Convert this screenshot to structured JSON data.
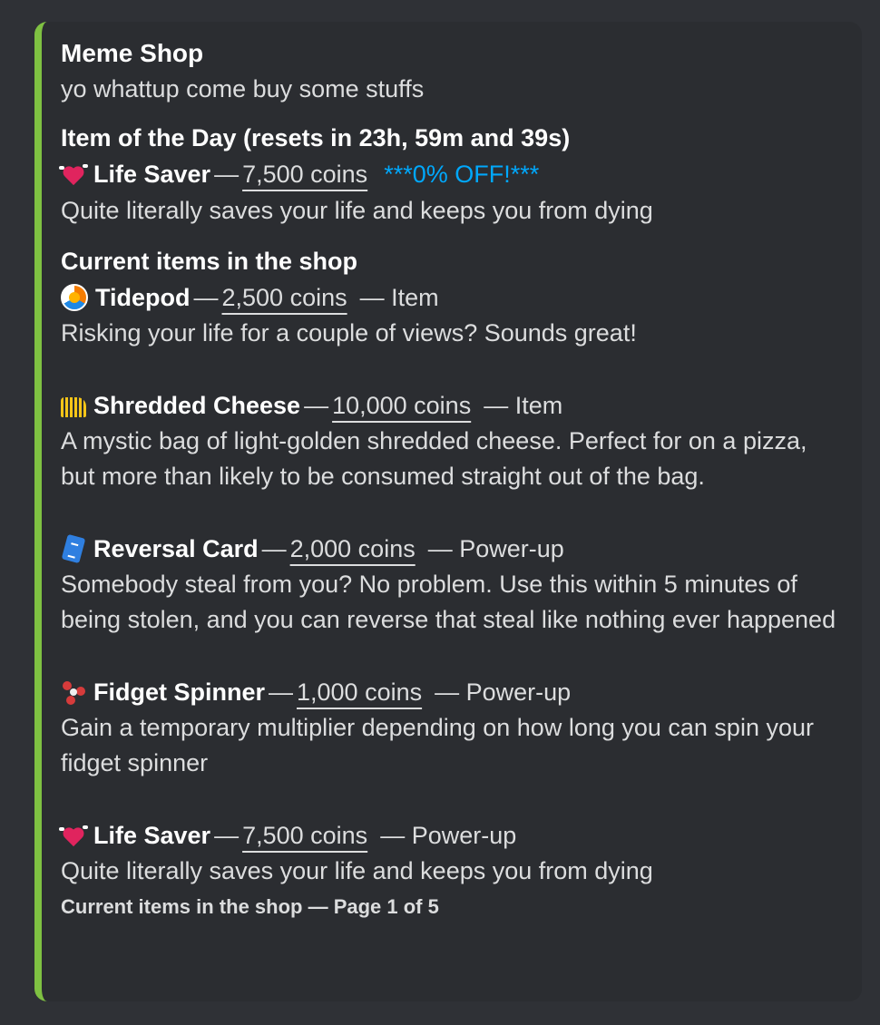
{
  "embed": {
    "accent": "#7fc142",
    "title": "Meme Shop",
    "description": "yo whattup come buy some stuffs",
    "item_of_day": {
      "heading": "Item of the Day (resets in 23h, 59m and 39s)",
      "icon": "heart-icon",
      "name": "Life Saver",
      "dash": "—",
      "price": "7,500 coins",
      "discount": "***0% OFF!***",
      "description": "Quite literally saves your life and keeps you from dying"
    },
    "current_heading": "Current items in the shop",
    "items": [
      {
        "icon": "tidepod-icon",
        "name": "Tidepod",
        "dash": "—",
        "price": "2,500 coins",
        "type": "— Item",
        "description": "Risking your life for a couple of views? Sounds great!"
      },
      {
        "icon": "cheese-icon",
        "name": "Shredded Cheese",
        "dash": "—",
        "price": "10,000 coins",
        "type": "— Item",
        "description": "A mystic bag of light-golden shredded cheese. Perfect for on a pizza, but more than likely to be consumed straight out of the bag."
      },
      {
        "icon": "card-icon",
        "name": "Reversal Card",
        "dash": "—",
        "price": "2,000 coins",
        "type": "— Power-up",
        "description": "Somebody steal from you? No problem. Use this within 5 minutes of being stolen, and you can reverse that steal like nothing ever happened"
      },
      {
        "icon": "spinner-icon",
        "name": "Fidget Spinner",
        "dash": "—",
        "price": "1,000 coins",
        "type": "— Power-up",
        "description": "Gain a temporary multiplier depending on how long you can spin your fidget spinner"
      },
      {
        "icon": "heart-icon",
        "name": "Life Saver",
        "dash": "—",
        "price": "7,500 coins",
        "type": "— Power-up",
        "description": "Quite literally saves your life and keeps you from dying"
      }
    ],
    "footer": "Current items in the shop — Page 1 of 5"
  }
}
